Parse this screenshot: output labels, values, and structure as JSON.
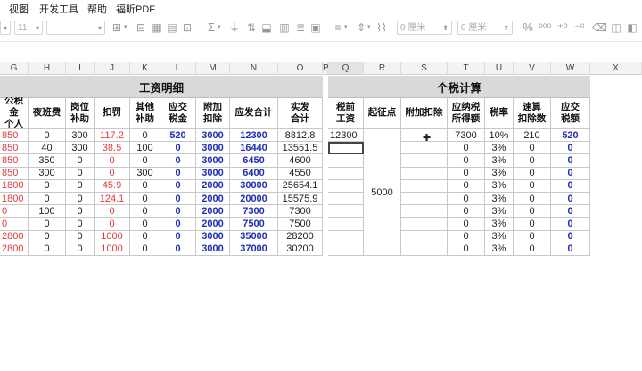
{
  "menu": [
    "视图",
    "开发工具",
    "帮助",
    "福昕PDF"
  ],
  "toolbar": {
    "font_size": "11",
    "margin1": "0 厘米",
    "margin2": "0 厘米"
  },
  "colors": {
    "red": "#e0393e",
    "blue": "#1f2fb5",
    "band": "#d9d9d9"
  },
  "columns": [
    "G",
    "H",
    "I",
    "J",
    "K",
    "L",
    "M",
    "N",
    "O",
    "P",
    "Q",
    "R",
    "S",
    "T",
    "U",
    "V",
    "W",
    "X"
  ],
  "left_title": "工资明细",
  "right_title": "个税计算",
  "left_headers": [
    "公积金\n个人",
    "夜班费",
    "岗位\n补助",
    "扣罚",
    "其他\n补助",
    "应交\n税金",
    "附加\n扣除",
    "应发合计",
    "实发\n合计"
  ],
  "right_headers": [
    "税前\n工资",
    "起征点",
    "附加扣除",
    "应纳税\n所得额",
    "税率",
    "速算\n扣除数",
    "应交\n税额"
  ],
  "rows": [
    {
      "g": "850",
      "h": "0",
      "i": "300",
      "j": "117.2",
      "k": "0",
      "l": "520",
      "m": "3000",
      "n": "12300",
      "o": "8812.8"
    },
    {
      "g": "850",
      "h": "40",
      "i": "300",
      "j": "38.5",
      "k": "100",
      "l": "0",
      "m": "3000",
      "n": "16440",
      "o": "13551.5"
    },
    {
      "g": "850",
      "h": "350",
      "i": "0",
      "j": "0",
      "k": "0",
      "l": "0",
      "m": "3000",
      "n": "6450",
      "o": "4600"
    },
    {
      "g": "850",
      "h": "300",
      "i": "0",
      "j": "0",
      "k": "300",
      "l": "0",
      "m": "3000",
      "n": "6400",
      "o": "4550"
    },
    {
      "g": "1800",
      "h": "0",
      "i": "0",
      "j": "45.9",
      "k": "0",
      "l": "0",
      "m": "2000",
      "n": "30000",
      "o": "25654.1"
    },
    {
      "g": "1800",
      "h": "0",
      "i": "0",
      "j": "124.1",
      "k": "0",
      "l": "0",
      "m": "2000",
      "n": "20000",
      "o": "15575.9"
    },
    {
      "g": "0",
      "h": "100",
      "i": "0",
      "j": "0",
      "k": "0",
      "l": "0",
      "m": "2000",
      "n": "7300",
      "o": "7300"
    },
    {
      "g": "0",
      "h": "0",
      "i": "0",
      "j": "0",
      "k": "0",
      "l": "0",
      "m": "2000",
      "n": "7500",
      "o": "7500"
    },
    {
      "g": "2800",
      "h": "0",
      "i": "0",
      "j": "1000",
      "k": "0",
      "l": "0",
      "m": "3000",
      "n": "35000",
      "o": "28200"
    },
    {
      "g": "2800",
      "h": "0",
      "i": "0",
      "j": "1000",
      "k": "0",
      "l": "0",
      "m": "3000",
      "n": "37000",
      "o": "30200"
    }
  ],
  "tax_rows": [
    {
      "q": "12300",
      "s": "",
      "t": "7300",
      "u": "10%",
      "v": "210",
      "w": "520"
    },
    {
      "q": "",
      "s": "",
      "t": "0",
      "u": "3%",
      "v": "0",
      "w": "0"
    },
    {
      "q": "",
      "s": "",
      "t": "0",
      "u": "3%",
      "v": "0",
      "w": "0"
    },
    {
      "q": "",
      "s": "",
      "t": "0",
      "u": "3%",
      "v": "0",
      "w": "0"
    },
    {
      "q": "",
      "s": "",
      "t": "0",
      "u": "3%",
      "v": "0",
      "w": "0"
    },
    {
      "q": "",
      "s": "",
      "t": "0",
      "u": "3%",
      "v": "0",
      "w": "0"
    },
    {
      "q": "",
      "s": "",
      "t": "0",
      "u": "3%",
      "v": "0",
      "w": "0"
    },
    {
      "q": "",
      "s": "",
      "t": "0",
      "u": "3%",
      "v": "0",
      "w": "0"
    },
    {
      "q": "",
      "s": "",
      "t": "0",
      "u": "3%",
      "v": "0",
      "w": "0"
    },
    {
      "q": "",
      "s": "",
      "t": "0",
      "u": "3%",
      "v": "0",
      "w": "0"
    }
  ],
  "threshold": "5000"
}
